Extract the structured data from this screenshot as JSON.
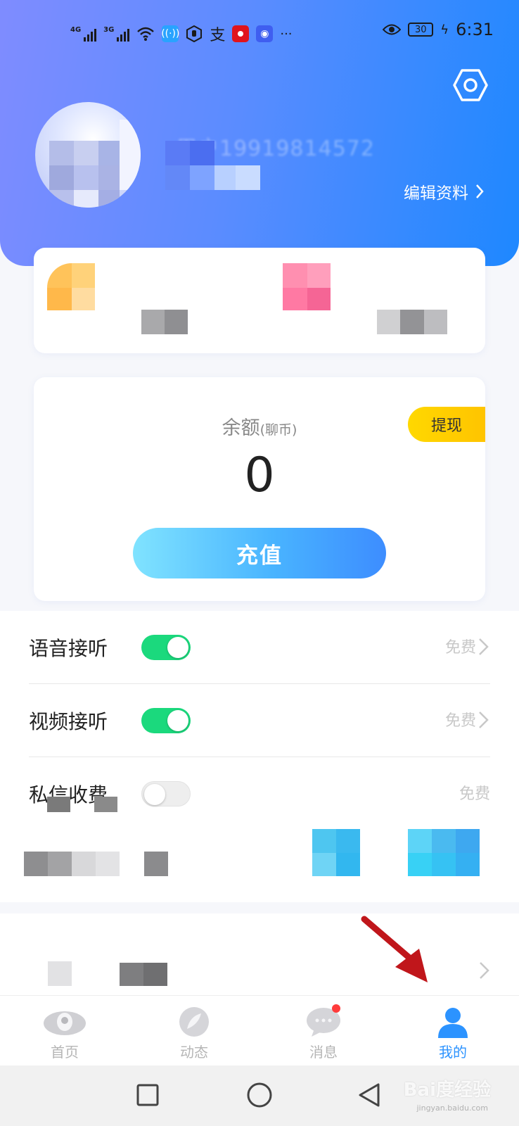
{
  "status_bar": {
    "time": "6:31",
    "battery": "30",
    "signal_labels": [
      "4G",
      "3G"
    ],
    "icons": [
      "wifi-icon",
      "hotspot-icon",
      "hand-icon",
      "alipay-icon",
      "app-red-icon",
      "app-blue-icon",
      "more-icon",
      "eye-icon",
      "battery-icon",
      "charging-icon"
    ]
  },
  "header": {
    "settings_icon": "hexagon-settings-icon",
    "blurred_name": "用户19919814572",
    "blurred_id": "19814572",
    "edit_profile_label": "编辑资料"
  },
  "balance": {
    "title": "余额",
    "unit": "(聊币)",
    "value": "0",
    "withdraw_label": "提现",
    "recharge_label": "充值"
  },
  "settings": [
    {
      "label": "语音接听",
      "enabled": true,
      "value": "免费"
    },
    {
      "label": "视频接听",
      "enabled": true,
      "value": "免费"
    },
    {
      "label": "私信收费",
      "enabled": false,
      "value": "免费"
    }
  ],
  "tabs": [
    {
      "label": "首页",
      "icon": "home-icon",
      "active": false
    },
    {
      "label": "动态",
      "icon": "feather-icon",
      "active": false
    },
    {
      "label": "消息",
      "icon": "chat-bubble-icon",
      "active": false,
      "badge": true
    },
    {
      "label": "我的",
      "icon": "person-icon",
      "active": true
    }
  ],
  "watermark": {
    "brand": "Bai度经验",
    "url": "jingyan.baidu.com"
  },
  "colors": {
    "header_gradient_start": "#7f8cff",
    "header_gradient_end": "#1e88ff",
    "toggle_on": "#1bd97d",
    "active_tab": "#2c93ff",
    "withdraw_yellow": "#ffd800",
    "arrow_red": "#c0161b"
  }
}
